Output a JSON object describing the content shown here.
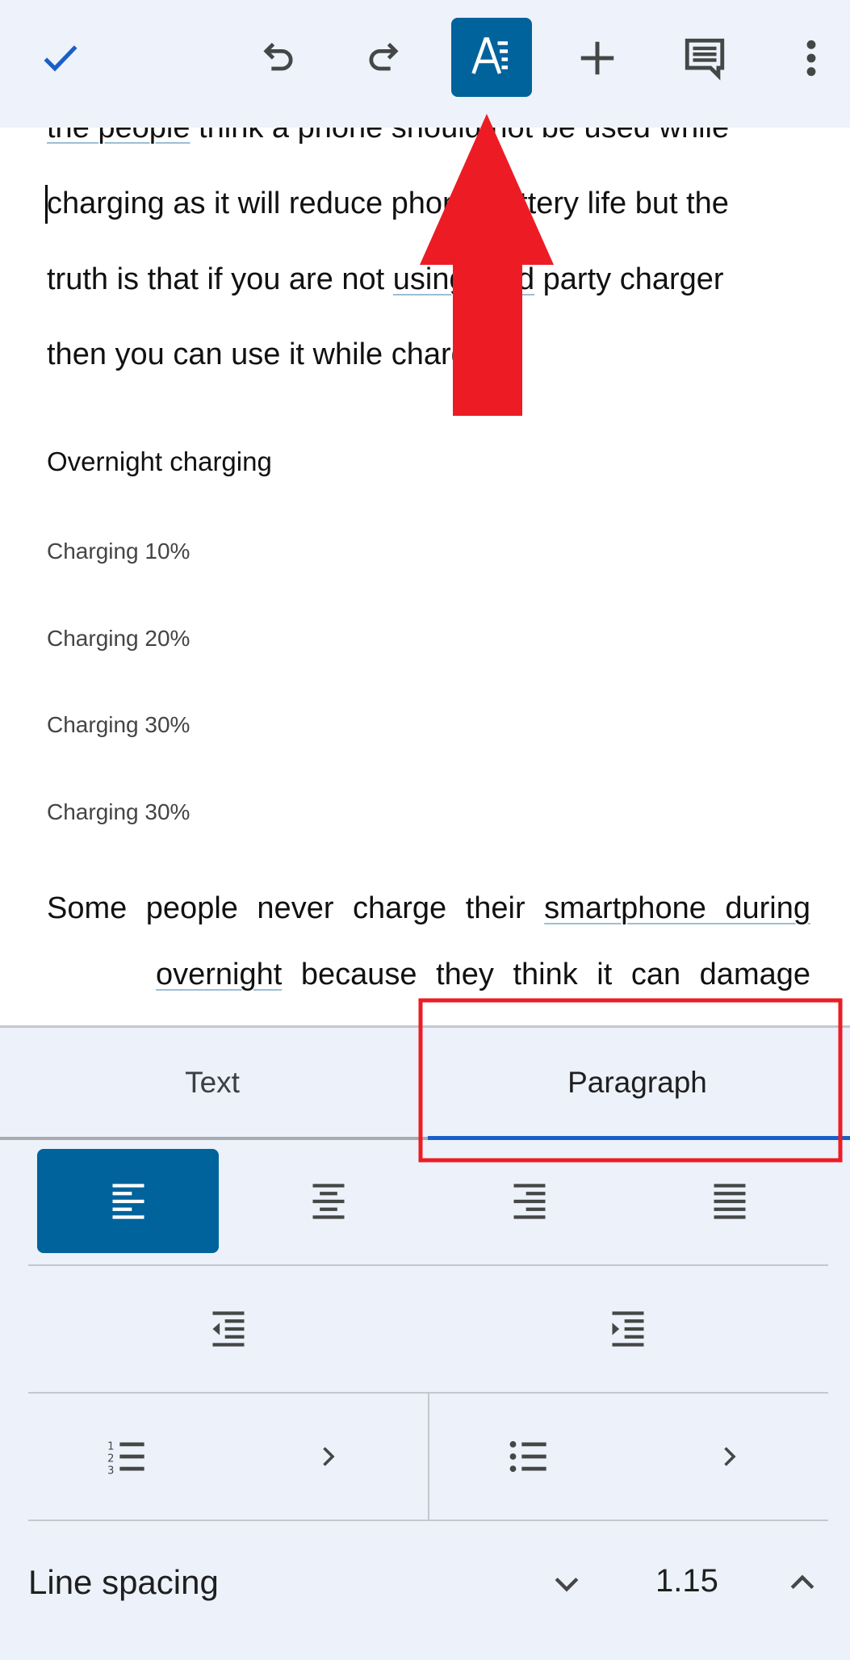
{
  "toolbar": {
    "icons": [
      "check-icon",
      "undo-icon",
      "redo-icon",
      "text-format-icon",
      "insert-plus-icon",
      "comment-icon",
      "more-vert-icon"
    ],
    "accent": "#00639b"
  },
  "document": {
    "lines": [
      {
        "pre": "",
        "link": "the people",
        "post": " think a phone should not be used while"
      },
      {
        "pre": "charging as it will reduce phone battery life but the",
        "link": "",
        "post": ""
      },
      {
        "pre": "truth is that if you are not ",
        "link": "using third",
        "post": " party charger"
      },
      {
        "pre": "then you can use it while charging.",
        "link": "",
        "post": ""
      }
    ],
    "heading": "Overnight charging",
    "items": [
      "Charging 10%",
      "Charging 20%",
      "Charging 30%",
      "Charging 30%"
    ],
    "para_line1": {
      "pre": "Some people never charge their ",
      "link": "smartphone during"
    },
    "para_line2": {
      "link": "overnight",
      "post": " because they think it can damage"
    }
  },
  "panel": {
    "tabs": [
      {
        "label": "Text",
        "selected": false
      },
      {
        "label": "Paragraph",
        "selected": true
      }
    ],
    "alignment": {
      "options": [
        "align-left",
        "align-center",
        "align-right",
        "align-justify"
      ],
      "selected": "align-left"
    },
    "line_spacing": {
      "label": "Line spacing",
      "value": "1.15"
    }
  },
  "annotations": {
    "color": "#ed1c24"
  }
}
